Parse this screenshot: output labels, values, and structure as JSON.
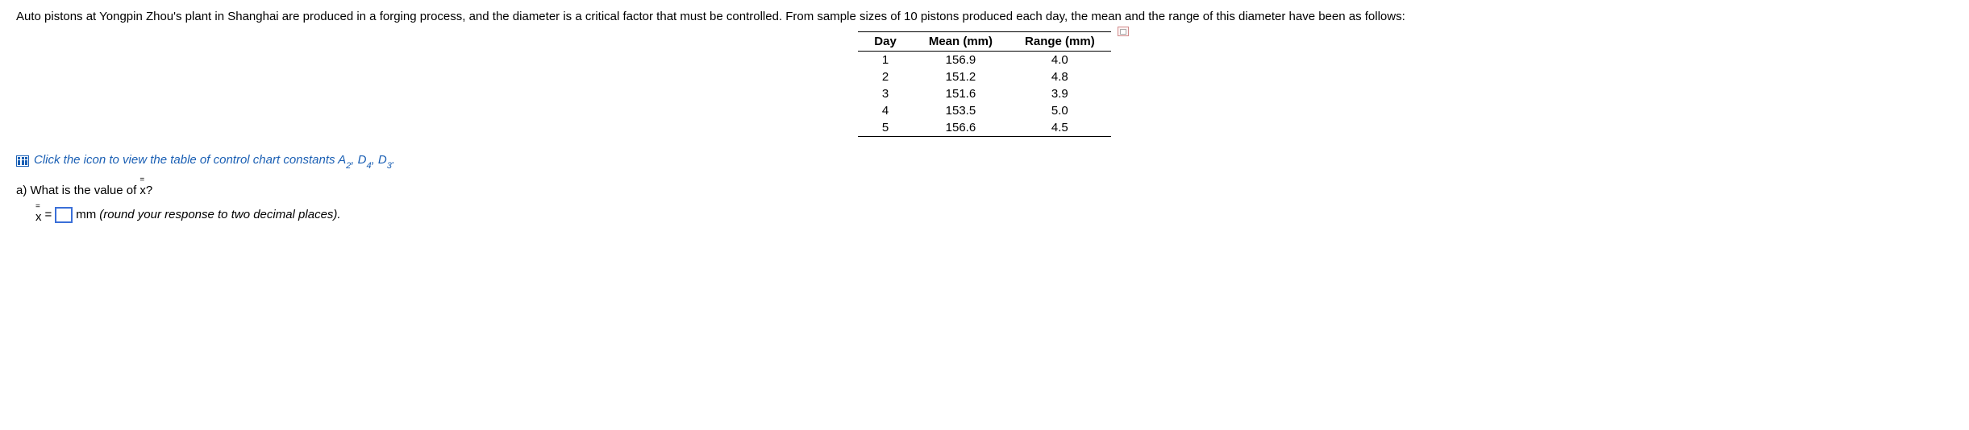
{
  "intro": "Auto pistons at Yongpin Zhou's plant in Shanghai are produced in a forging process, and the diameter is a critical factor that must be controlled. From sample sizes of 10 pistons produced each day, the mean and the range of this diameter have been as follows:",
  "table": {
    "headers": {
      "day": "Day",
      "mean": "Mean (mm)",
      "range": "Range (mm)"
    },
    "rows": [
      {
        "day": "1",
        "mean": "156.9",
        "range": "4.0"
      },
      {
        "day": "2",
        "mean": "151.2",
        "range": "4.8"
      },
      {
        "day": "3",
        "mean": "151.6",
        "range": "3.9"
      },
      {
        "day": "4",
        "mean": "153.5",
        "range": "5.0"
      },
      {
        "day": "5",
        "mean": "156.6",
        "range": "4.5"
      }
    ]
  },
  "link": {
    "pre": "Click the icon to view the table of control chart constants A",
    "s1": "2",
    "mid1": ", D",
    "s2": "4",
    "mid2": ", D",
    "s3": "3",
    "post": "."
  },
  "question": {
    "label": "a) What is the value of x?",
    "x": "x",
    "eq": " = ",
    "unit": "mm",
    "hint": "(round your response to two decimal places)."
  }
}
